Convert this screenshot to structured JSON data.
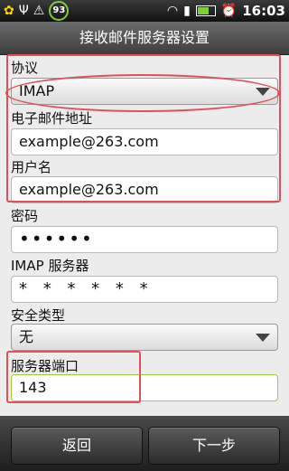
{
  "status_bar": {
    "notification_badge": "93",
    "time": "16:03",
    "icons": [
      "brand-icon",
      "usb-icon",
      "warning-icon",
      "wifi-icon",
      "signal-icon",
      "battery-icon",
      "alarm-icon"
    ]
  },
  "header": {
    "title": "接收邮件服务器设置"
  },
  "form": {
    "protocol": {
      "label": "协议",
      "value": "IMAP"
    },
    "email": {
      "label": "电子邮件地址",
      "value": "example@263.com"
    },
    "username": {
      "label": "用户名",
      "value": "example@263.com"
    },
    "password": {
      "label": "密码",
      "value": "••••••"
    },
    "imap_server": {
      "label": "IMAP 服务器",
      "value": "* * * * * *"
    },
    "security_type": {
      "label": "安全类型",
      "value": "无"
    },
    "server_port": {
      "label": "服务器端口",
      "value": "143"
    }
  },
  "footer": {
    "back_label": "返回",
    "next_label": "下一步"
  },
  "colors": {
    "highlight": "#e0505a",
    "accent_green": "#9ccf3a"
  }
}
